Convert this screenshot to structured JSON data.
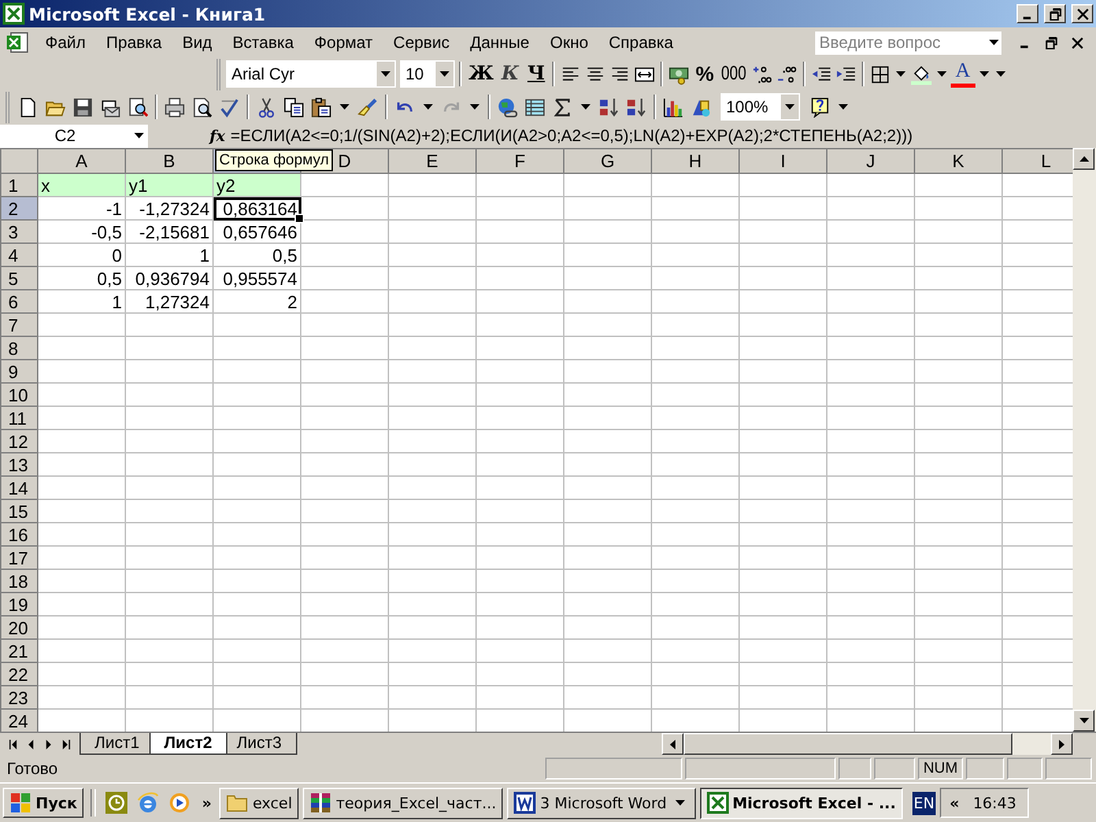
{
  "window": {
    "title": "Microsoft Excel - Книга1"
  },
  "menu": [
    {
      "label": "Файл"
    },
    {
      "label": "Правка"
    },
    {
      "label": "Вид"
    },
    {
      "label": "Вставка"
    },
    {
      "label": "Формат"
    },
    {
      "label": "Сервис"
    },
    {
      "label": "Данные"
    },
    {
      "label": "Окно"
    },
    {
      "label": "Справка"
    }
  ],
  "help_search": {
    "placeholder": "Введите вопрос"
  },
  "formatting_toolbar": {
    "font": "Arial Cyr",
    "size": "10",
    "bold": "Ж",
    "italic": "К",
    "underline": "Ч",
    "percent": "%",
    "thousands": "000",
    "font_color": "A"
  },
  "standard_toolbar": {
    "zoom": "100%"
  },
  "formula_bar": {
    "name_box": "C2",
    "function_label": "fx",
    "formula": "=ЕСЛИ(A2<=0;1/(SIN(A2)+2);ЕСЛИ(И(A2>0;A2<=0,5);LN(A2)+EXP(A2);2*СТЕПЕНЬ(A2;2)))"
  },
  "tooltip": {
    "text": "Строка формул"
  },
  "columns": [
    {
      "label": "A",
      "selected": false
    },
    {
      "label": "B",
      "selected": false
    },
    {
      "selected": true
    },
    {
      "label": "D",
      "selected": false
    },
    {
      "label": "E",
      "selected": false
    },
    {
      "label": "F",
      "selected": false
    },
    {
      "label": "G",
      "selected": false
    },
    {
      "label": "H",
      "selected": false
    },
    {
      "label": "I",
      "selected": false
    },
    {
      "label": "J",
      "selected": false
    },
    {
      "label": "K",
      "selected": false
    },
    {
      "label": "L",
      "selected": false
    }
  ],
  "rows": [
    {
      "label": "1",
      "selected": false,
      "cells": [
        {
          "value": "x",
          "kind": "text",
          "highlighted": true,
          "selected": false
        },
        {
          "value": "y1",
          "kind": "text",
          "highlighted": true,
          "selected": false
        },
        {
          "value": "y2",
          "kind": "text",
          "highlighted": true,
          "selected": false
        }
      ]
    },
    {
      "label": "2",
      "selected": true,
      "cells": [
        {
          "value": "-1",
          "kind": "number",
          "highlighted": false,
          "selected": false
        },
        {
          "value": "-1,27324",
          "kind": "number",
          "highlighted": false,
          "selected": false
        },
        {
          "value": "0,863164",
          "kind": "number",
          "highlighted": false,
          "selected": true
        }
      ]
    },
    {
      "label": "3",
      "selected": false,
      "cells": [
        {
          "value": "-0,5",
          "kind": "number",
          "highlighted": false,
          "selected": false
        },
        {
          "value": "-2,15681",
          "kind": "number",
          "highlighted": false,
          "selected": false
        },
        {
          "value": "0,657646",
          "kind": "number",
          "highlighted": false,
          "selected": false
        }
      ]
    },
    {
      "label": "4",
      "selected": false,
      "cells": [
        {
          "value": "0",
          "kind": "number",
          "highlighted": false,
          "selected": false
        },
        {
          "value": "1",
          "kind": "number",
          "highlighted": false,
          "selected": false
        },
        {
          "value": "0,5",
          "kind": "number",
          "highlighted": false,
          "selected": false
        }
      ]
    },
    {
      "label": "5",
      "selected": false,
      "cells": [
        {
          "value": "0,5",
          "kind": "number",
          "highlighted": false,
          "selected": false
        },
        {
          "value": "0,936794",
          "kind": "number",
          "highlighted": false,
          "selected": false
        },
        {
          "value": "0,955574",
          "kind": "number",
          "highlighted": false,
          "selected": false
        }
      ]
    },
    {
      "label": "6",
      "selected": false,
      "cells": [
        {
          "value": "1",
          "kind": "number",
          "highlighted": false,
          "selected": false
        },
        {
          "value": "1,27324",
          "kind": "number",
          "highlighted": false,
          "selected": false
        },
        {
          "value": "2",
          "kind": "number",
          "highlighted": false,
          "selected": false
        }
      ]
    },
    {
      "label": "7",
      "selected": false
    },
    {
      "label": "8",
      "selected": false
    },
    {
      "label": "9",
      "selected": false
    },
    {
      "label": "10",
      "selected": false
    },
    {
      "label": "11",
      "selected": false
    },
    {
      "label": "12",
      "selected": false
    },
    {
      "label": "13",
      "selected": false
    },
    {
      "label": "14",
      "selected": false
    },
    {
      "label": "15",
      "selected": false
    },
    {
      "label": "16",
      "selected": false
    },
    {
      "label": "17",
      "selected": false
    },
    {
      "label": "18",
      "selected": false
    },
    {
      "label": "19",
      "selected": false
    },
    {
      "label": "20",
      "selected": false
    },
    {
      "label": "21",
      "selected": false
    },
    {
      "label": "22",
      "selected": false
    },
    {
      "label": "23",
      "selected": false
    },
    {
      "label": "24",
      "selected": false
    }
  ],
  "sheet_tabs": [
    {
      "label": "Лист1",
      "selected": false
    },
    {
      "label": "Лист2",
      "selected": true
    },
    {
      "label": "Лист3",
      "selected": false
    }
  ],
  "status_bar": {
    "text": "Готово",
    "indicator": "NUM"
  },
  "taskbar": {
    "start": "Пуск",
    "more": "»",
    "tasks": [
      {
        "label": "excel",
        "kind": "folder",
        "selected": false,
        "grouped": false
      },
      {
        "label": "теория_Excel_част...",
        "kind": "archive",
        "selected": false,
        "grouped": false
      },
      {
        "label": "3 Microsoft Word",
        "kind": "word",
        "selected": false,
        "grouped": true
      },
      {
        "label": "Microsoft Excel - ...",
        "kind": "excel",
        "selected": true,
        "grouped": false
      }
    ],
    "language": "EN",
    "tray_toggle": "«",
    "clock": "16:43"
  }
}
